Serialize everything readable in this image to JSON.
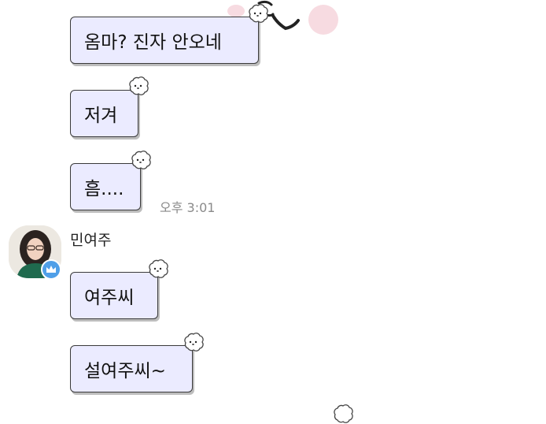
{
  "messages": [
    {
      "text": "옴마? 진자 안오네"
    },
    {
      "text": "저겨"
    },
    {
      "text": "흠...."
    },
    {
      "text": "여주씨"
    },
    {
      "text": "설여주씨~"
    }
  ],
  "timestamp": "오후 3:01",
  "sender": {
    "name": "민여주",
    "avatar_icon": "profile-photo",
    "badge_icon": "crown-icon"
  },
  "colors": {
    "bubble_bg": "#ebebff",
    "bubble_border": "#3a3a3a",
    "timestamp_text": "#8a8a8a",
    "badge": "#4f9fe8",
    "cheek_decoration": "#f7dbe1"
  }
}
